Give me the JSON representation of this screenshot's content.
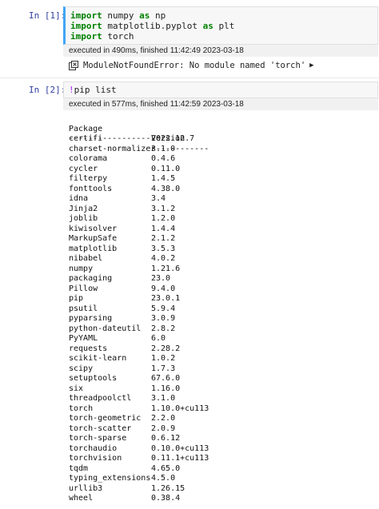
{
  "cell1": {
    "prompt": "In [1]:",
    "code": [
      {
        "kw1": "import",
        "rest1": " numpy ",
        "kw2": "as",
        "rest2": " np"
      },
      {
        "kw1": "import",
        "rest1": " matplotlib.pyplot ",
        "kw2": "as",
        "rest2": " plt"
      },
      {
        "kw1": "import",
        "rest1": " torch",
        "kw2": "",
        "rest2": ""
      }
    ],
    "exec_status": "executed in 490ms, finished 11:42:49 2023-03-18",
    "error_text": "ModuleNotFoundError: No module named 'torch'",
    "error_icon": "error-icon",
    "expand_icon": "expand-triangle-icon"
  },
  "cell2": {
    "prompt": "In [2]:",
    "code": {
      "bang": "!",
      "cmd": "pip list"
    },
    "exec_status": "executed in 577ms, finished 11:42:59 2023-03-18",
    "header": {
      "name": "Package",
      "version": "Version"
    },
    "separator": {
      "name": "------------------",
      "version": "------------"
    },
    "packages": [
      {
        "name": "certifi",
        "version": "2022.12.7"
      },
      {
        "name": "charset-normalizer",
        "version": "3.1.0"
      },
      {
        "name": "colorama",
        "version": "0.4.6"
      },
      {
        "name": "cycler",
        "version": "0.11.0"
      },
      {
        "name": "filterpy",
        "version": "1.4.5"
      },
      {
        "name": "fonttools",
        "version": "4.38.0"
      },
      {
        "name": "idna",
        "version": "3.4"
      },
      {
        "name": "Jinja2",
        "version": "3.1.2"
      },
      {
        "name": "joblib",
        "version": "1.2.0"
      },
      {
        "name": "kiwisolver",
        "version": "1.4.4"
      },
      {
        "name": "MarkupSafe",
        "version": "2.1.2"
      },
      {
        "name": "matplotlib",
        "version": "3.5.3"
      },
      {
        "name": "nibabel",
        "version": "4.0.2"
      },
      {
        "name": "numpy",
        "version": "1.21.6"
      },
      {
        "name": "packaging",
        "version": "23.0"
      },
      {
        "name": "Pillow",
        "version": "9.4.0"
      },
      {
        "name": "pip",
        "version": "23.0.1"
      },
      {
        "name": "psutil",
        "version": "5.9.4"
      },
      {
        "name": "pyparsing",
        "version": "3.0.9"
      },
      {
        "name": "python-dateutil",
        "version": "2.8.2"
      },
      {
        "name": "PyYAML",
        "version": "6.0"
      },
      {
        "name": "requests",
        "version": "2.28.2"
      },
      {
        "name": "scikit-learn",
        "version": "1.0.2"
      },
      {
        "name": "scipy",
        "version": "1.7.3"
      },
      {
        "name": "setuptools",
        "version": "67.6.0"
      },
      {
        "name": "six",
        "version": "1.16.0"
      },
      {
        "name": "threadpoolctl",
        "version": "3.1.0"
      },
      {
        "name": "torch",
        "version": "1.10.0+cu113"
      },
      {
        "name": "torch-geometric",
        "version": "2.2.0"
      },
      {
        "name": "torch-scatter",
        "version": "2.0.9"
      },
      {
        "name": "torch-sparse",
        "version": "0.6.12"
      },
      {
        "name": "torchaudio",
        "version": "0.10.0+cu113"
      },
      {
        "name": "torchvision",
        "version": "0.11.1+cu113"
      },
      {
        "name": "tqdm",
        "version": "4.65.0"
      },
      {
        "name": "typing_extensions",
        "version": "4.5.0"
      },
      {
        "name": "urllib3",
        "version": "1.26.15"
      },
      {
        "name": "wheel",
        "version": "0.38.4"
      }
    ]
  }
}
